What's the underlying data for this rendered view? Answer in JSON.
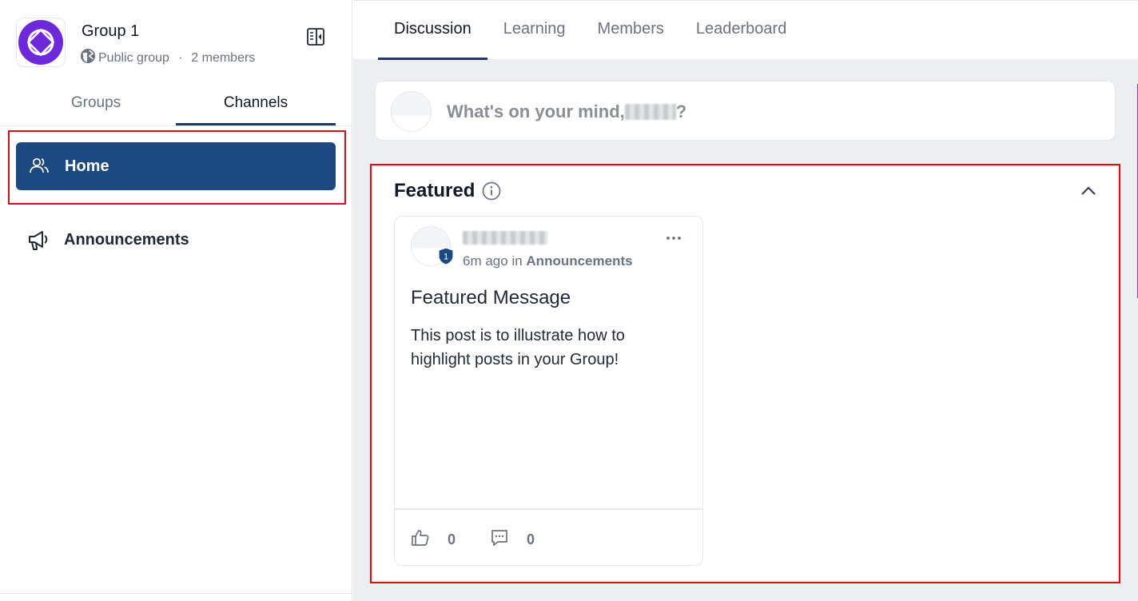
{
  "group": {
    "name": "Group 1",
    "privacy": "Public group",
    "separator": "·",
    "members": "2 members"
  },
  "sidebar": {
    "tabs": [
      {
        "label": "Groups",
        "active": false
      },
      {
        "label": "Channels",
        "active": true
      }
    ],
    "channels": [
      {
        "label": "Home",
        "icon": "users-icon",
        "active": true
      },
      {
        "label": "Announcements",
        "icon": "megaphone-icon",
        "active": false
      }
    ]
  },
  "main": {
    "tabs": [
      {
        "label": "Discussion",
        "active": true
      },
      {
        "label": "Learning",
        "active": false
      },
      {
        "label": "Members",
        "active": false
      },
      {
        "label": "Leaderboard",
        "active": false
      }
    ],
    "composer": {
      "prompt_prefix": "What's on your mind, ",
      "prompt_suffix": "?"
    },
    "featured": {
      "title": "Featured",
      "post": {
        "rank": "1",
        "time": "6m ago",
        "in_word": "in",
        "channel": "Announcements",
        "title": "Featured Message",
        "body": "This post is to illustrate how to highlight posts in your Group!",
        "likes": "0",
        "comments": "0"
      }
    }
  },
  "colors": {
    "brand": "#1c4a80",
    "logo": "#6d28d9",
    "highlight": "#d30f17"
  }
}
